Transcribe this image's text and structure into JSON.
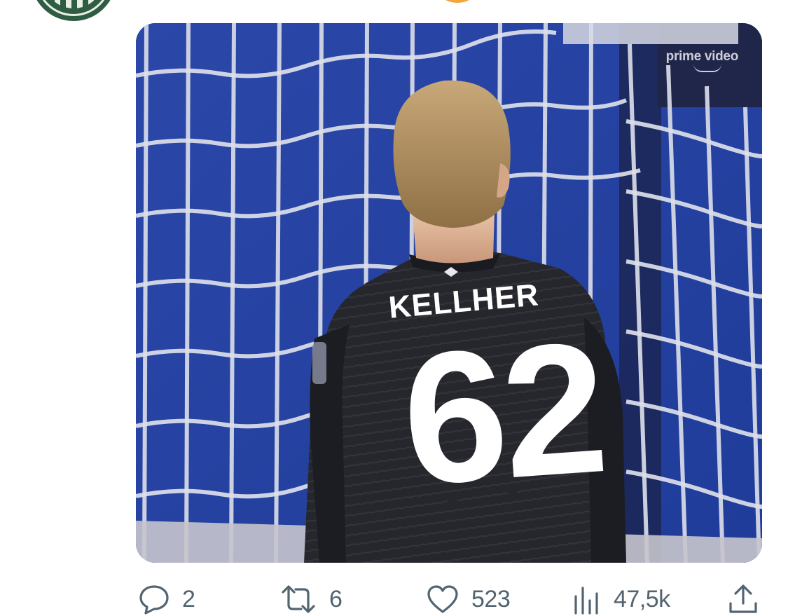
{
  "tweet": {
    "media": {
      "watermark": "prime video",
      "jersey_name": "KELLHER",
      "jersey_number": "62"
    },
    "actions": {
      "replies": "2",
      "reposts": "6",
      "likes": "523",
      "views": "47,5k"
    }
  },
  "icons": {
    "reply": "reply-icon",
    "repost": "repost-icon",
    "like": "like-icon",
    "views": "views-icon",
    "share": "share-icon"
  },
  "colors": {
    "action_gray": "#536471",
    "net_blue": "#2244aa"
  }
}
